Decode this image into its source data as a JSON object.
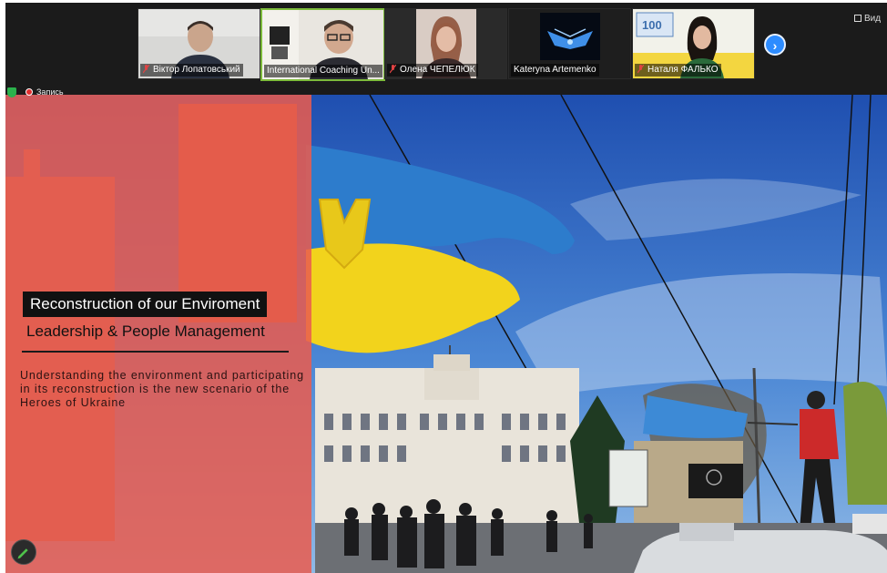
{
  "meeting": {
    "view_label": "Вид",
    "recording_label": "Запись",
    "participants": [
      {
        "name": "Віктор Лопатовський",
        "muted": true
      },
      {
        "name": "International Coaching Un...",
        "muted": false,
        "active": true
      },
      {
        "name": "Олена ЧЕПЕЛЮК",
        "muted": true
      },
      {
        "name": "Kateryna Artemenko",
        "muted": false
      },
      {
        "name": "Наталя ФАЛЬКО",
        "muted": true
      }
    ]
  },
  "slide": {
    "title": "Reconstruction of our Enviroment",
    "subtitle": "Leadership & People Management",
    "body": "Understanding the environment and participating in its reconstruction is the new scenario of the Heroes of Ukraine"
  },
  "colors": {
    "panel_red": "#ea5c4e",
    "zoom_blue": "#2d8cff",
    "active_green": "#7dbb3b"
  }
}
